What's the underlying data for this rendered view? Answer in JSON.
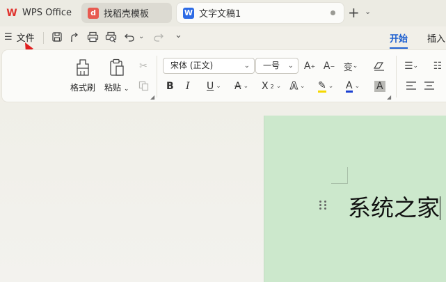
{
  "tabs": [
    {
      "label": "WPS Office",
      "icon": "wps-logo-icon"
    },
    {
      "label": "找稻壳模板",
      "icon": "docer-logo-icon"
    },
    {
      "label": "文字文稿1",
      "icon": "writer-doc-icon"
    }
  ],
  "menu": {
    "file_label": "文件",
    "ribbon_tabs": [
      "开始",
      "插入"
    ]
  },
  "ribbon": {
    "format_painter": "格式刷",
    "paste": "粘贴",
    "font_name": "宋体 (正文)",
    "font_size": "一号"
  },
  "document": {
    "text": "系统之家"
  },
  "colors": {
    "accent": "#1d5fd0",
    "page_background": "#cce8cc",
    "annotation_arrow": "#e02020",
    "highlight_yellow": "#f5d800",
    "font_color_blue": "#1a3fd1"
  }
}
